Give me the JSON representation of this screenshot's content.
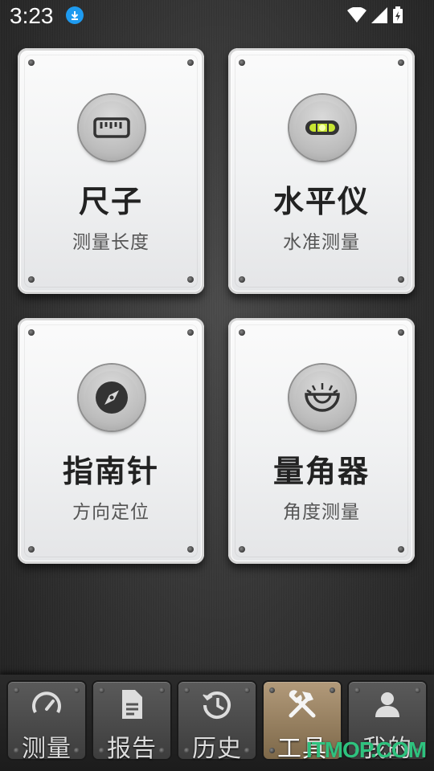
{
  "status_bar": {
    "time": "3:23"
  },
  "cards": [
    {
      "title": "尺子",
      "subtitle": "测量长度",
      "icon": "ruler-icon"
    },
    {
      "title": "水平仪",
      "subtitle": "水准测量",
      "icon": "level-icon"
    },
    {
      "title": "指南针",
      "subtitle": "方向定位",
      "icon": "compass-icon"
    },
    {
      "title": "量角器",
      "subtitle": "角度测量",
      "icon": "protractor-icon"
    }
  ],
  "tabs": [
    {
      "label": "测量",
      "icon": "speedometer-icon",
      "active": false
    },
    {
      "label": "报告",
      "icon": "document-icon",
      "active": false
    },
    {
      "label": "历史",
      "icon": "history-icon",
      "active": false
    },
    {
      "label": "工具",
      "icon": "tools-icon",
      "active": true
    },
    {
      "label": "我的",
      "icon": "user-icon",
      "active": false
    }
  ],
  "watermark": "ITMOP.COM",
  "colors": {
    "accent_active_tab": "#b29a7a",
    "download_badge": "#1e9bf0",
    "level_bubble": "#c8e632",
    "watermark": "#2ec27e"
  }
}
